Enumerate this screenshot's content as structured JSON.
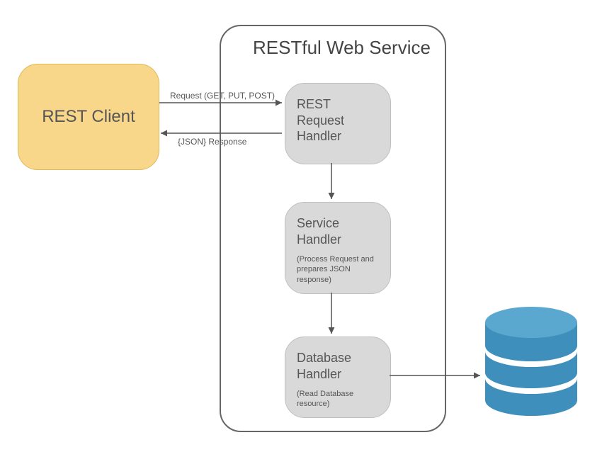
{
  "client": {
    "label": "REST Client"
  },
  "service": {
    "title": "RESTful Web Service",
    "requestHandler": {
      "title": "REST\nRequest\nHandler"
    },
    "serviceHandler": {
      "title": "Service\nHandler",
      "subtitle": "(Process Request and prepares JSON response)"
    },
    "databaseHandler": {
      "title": "Database\nHandler",
      "subtitle": "(Read Database resource)"
    }
  },
  "arrows": {
    "requestLabel": "Request (GET, PUT, POST)",
    "responseLabel": "{JSON} Response"
  },
  "database": {
    "name": "database-storage"
  }
}
